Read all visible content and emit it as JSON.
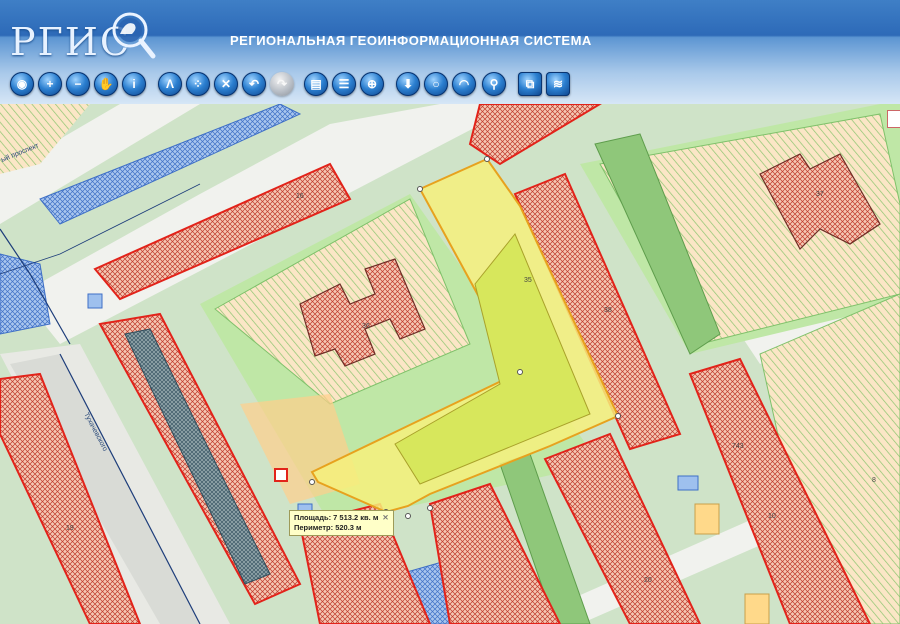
{
  "app": {
    "logo_text": "РГИС",
    "title": "РЕГИОНАЛЬНАЯ  ГЕОИНФОРМАЦИОННАЯ СИСТЕМА"
  },
  "toolbar": {
    "buttons": [
      {
        "name": "globe-home-button",
        "glyph": "◉",
        "enabled": true
      },
      {
        "name": "zoom-in-button",
        "glyph": "+",
        "enabled": true
      },
      {
        "name": "zoom-out-button",
        "glyph": "−",
        "enabled": true
      },
      {
        "name": "pan-hand-button",
        "glyph": "✋",
        "enabled": true
      },
      {
        "name": "info-button",
        "glyph": "i",
        "enabled": true
      },
      {
        "name": "measure-line-button",
        "glyph": "Λ",
        "enabled": true
      },
      {
        "name": "measure-area-button",
        "glyph": "⁘",
        "enabled": true
      },
      {
        "name": "clear-button",
        "glyph": "✕",
        "enabled": true
      },
      {
        "name": "undo-button",
        "glyph": "↶",
        "enabled": true
      },
      {
        "name": "redo-button",
        "glyph": "↷",
        "enabled": false
      },
      {
        "name": "print-button",
        "glyph": "▤",
        "enabled": true
      },
      {
        "name": "legend-list-button",
        "glyph": "☰",
        "enabled": true
      },
      {
        "name": "layers-globe-button",
        "glyph": "⊕",
        "enabled": true
      },
      {
        "name": "download-button",
        "glyph": "⬇",
        "enabled": true
      },
      {
        "name": "search-button",
        "glyph": "○",
        "enabled": true
      },
      {
        "name": "rss-button",
        "glyph": "◠",
        "enabled": true
      },
      {
        "name": "location-pin-button",
        "glyph": "⚲",
        "enabled": true
      },
      {
        "name": "export-map-button",
        "glyph": "⧉",
        "enabled": true
      },
      {
        "name": "overview-map-button",
        "glyph": "≋",
        "enabled": true
      }
    ]
  },
  "map": {
    "parcel_numbers": [
      "16",
      "36",
      "35",
      "37",
      "38",
      "19",
      "20",
      "743",
      "10",
      "8"
    ],
    "street_labels": [
      "ый проспект",
      "Тухачевского"
    ],
    "colors": {
      "parcel_red": "#e2231a",
      "hatch_green": "#7fc16a",
      "zone_orange": "#ffb666",
      "zone_blue": "#5b8fe0",
      "selection_yellow": "#f6f07c",
      "selection_fill_green": "#d8e85c",
      "road": "#f2f2ec"
    }
  },
  "measurement": {
    "area_label": "Площадь: 7 513.2 кв. м",
    "perimeter_label": "Периметр: 520.3 м"
  }
}
